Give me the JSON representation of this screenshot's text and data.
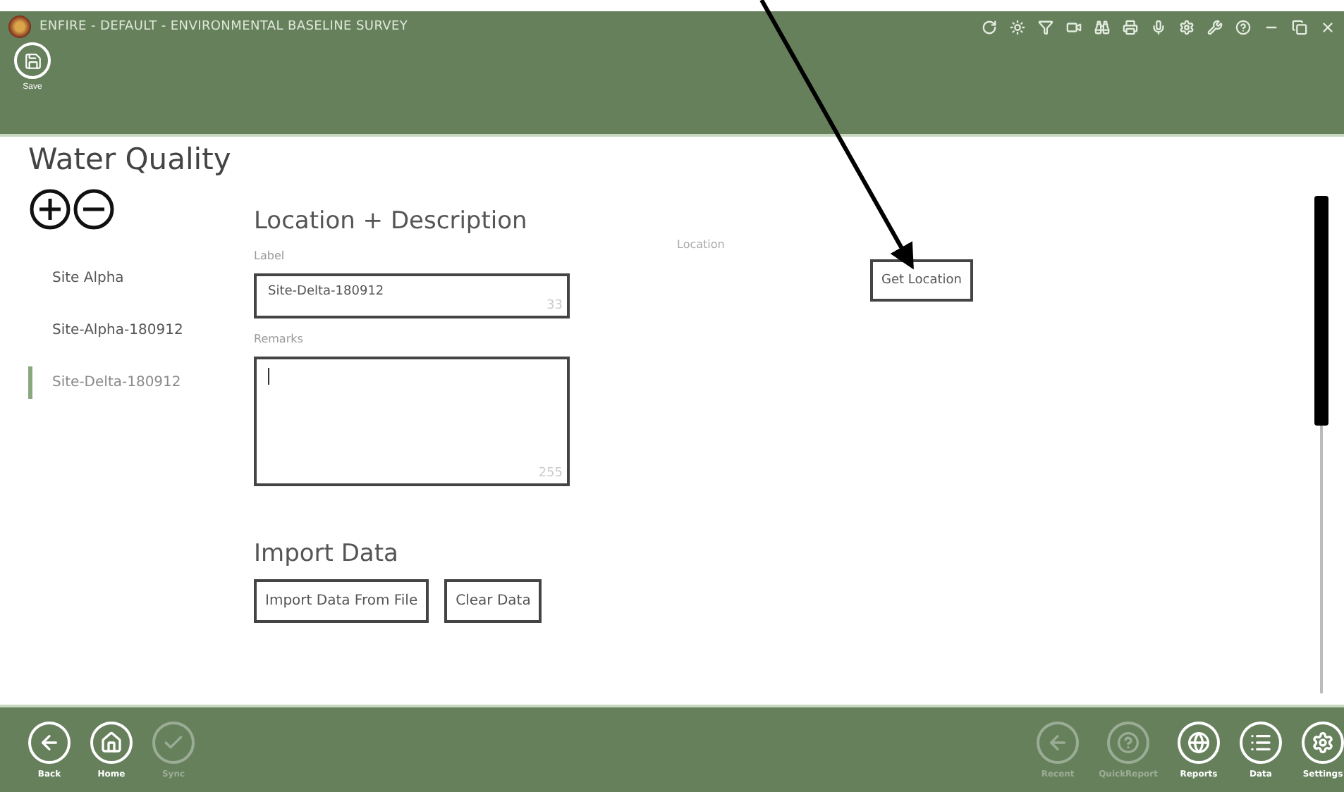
{
  "window": {
    "title": "ENFIRE - DEFAULT - ENVIRONMENTAL BASELINE SURVEY"
  },
  "ribbon": {
    "buttons": [
      {
        "label": "Save",
        "disabled": false
      }
    ]
  },
  "page": {
    "title": "Water Quality"
  },
  "sites": [
    {
      "label": "Site Alpha",
      "selected": false
    },
    {
      "label": "Site-Alpha-180912",
      "selected": false
    },
    {
      "label": "Site-Delta-180912",
      "selected": true
    }
  ],
  "form": {
    "heading": "Location + Description",
    "label_field": {
      "label": "Label",
      "value": "Site-Delta-180912",
      "counter": "33"
    },
    "remarks_field": {
      "label": "Remarks",
      "counter": "255"
    },
    "import_heading": "Import Data",
    "import_buttons": [
      "Import Data From File",
      "Clear Data"
    ]
  },
  "location": {
    "label": "Location",
    "button": "Get Location"
  },
  "footer": {
    "left": [
      {
        "label": "Back",
        "disabled": false
      },
      {
        "label": "Home",
        "disabled": false
      },
      {
        "label": "Sync",
        "disabled": true
      }
    ],
    "right": [
      {
        "label": "Recent",
        "disabled": true
      },
      {
        "label": "QuickReport",
        "disabled": true
      },
      {
        "label": "Reports",
        "disabled": false
      },
      {
        "label": "Data",
        "disabled": false
      },
      {
        "label": "Settings",
        "disabled": false
      }
    ]
  }
}
